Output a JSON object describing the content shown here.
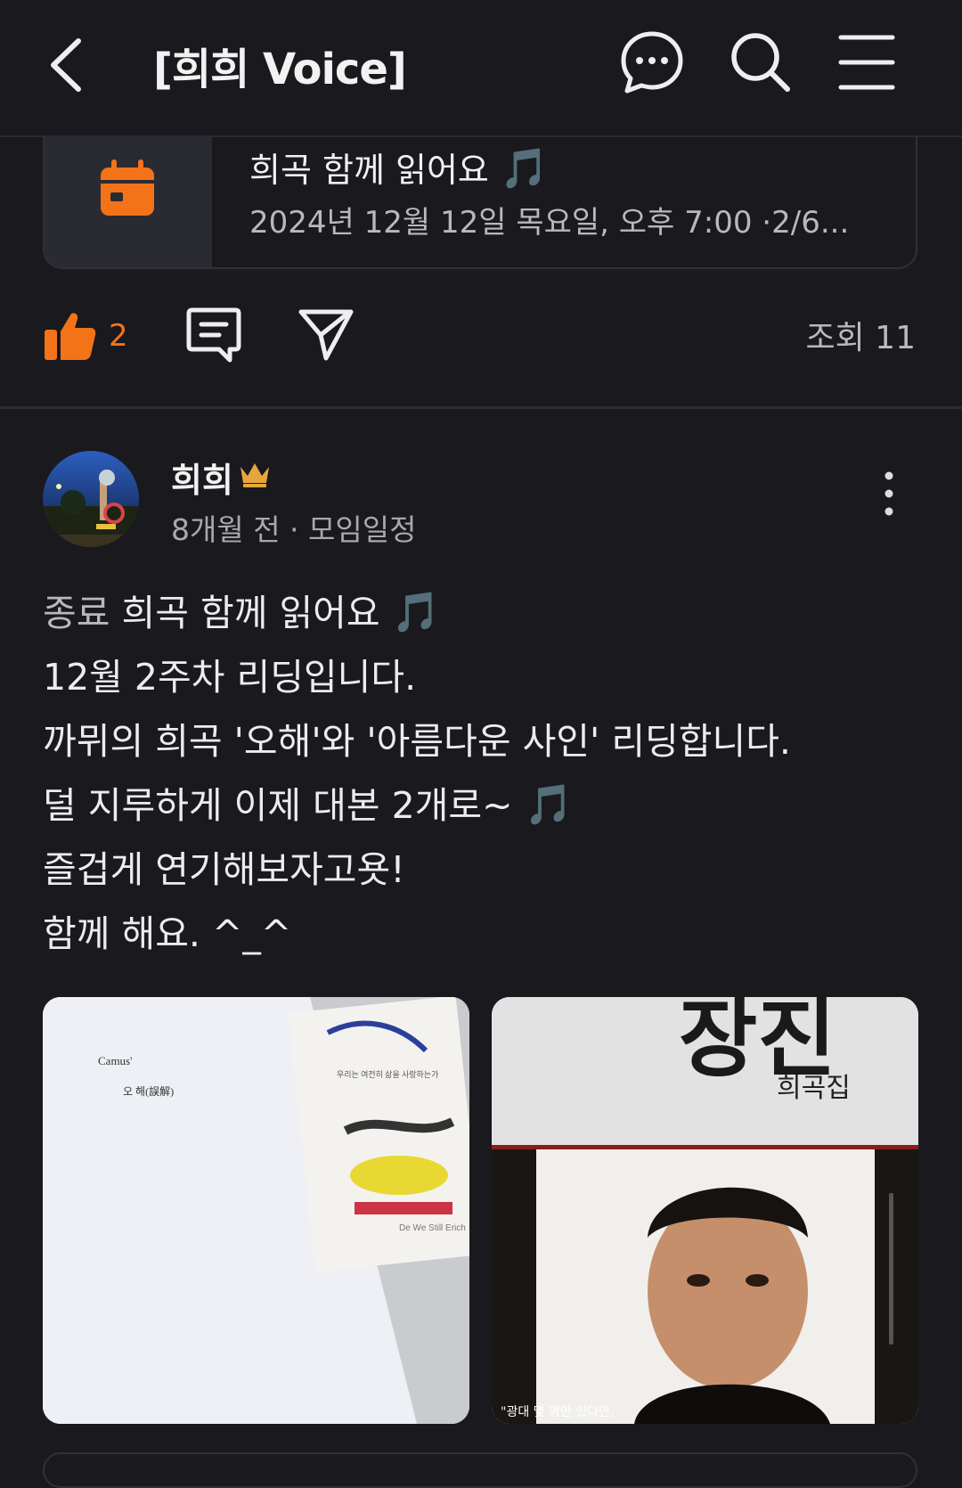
{
  "header": {
    "title": "[희희 Voice]",
    "back_icon": "chevron-left-icon",
    "chat_icon": "chat-bubble-icon",
    "search_icon": "search-icon",
    "menu_icon": "hamburger-menu-icon"
  },
  "event": {
    "title": "희곡 함께 읽어요",
    "subtitle": "2024년 12월 12일 목요일, 오후 7:00 ·2/6...",
    "icon": "calendar-icon",
    "icon_color": "#f47318"
  },
  "actions": {
    "like_count": "2",
    "views": "조회 11",
    "accent_color": "#f47318"
  },
  "post": {
    "author": "희희",
    "meta": "8개월 전 · 모임일정",
    "status_label": "종료",
    "title_text": "희곡 함께 읽어요",
    "music_glyph": "🎵",
    "lines": [
      "12월 2주차 리딩입니다.",
      "까뮈의 희곡 '오해'와 '아름다운 사인' 리딩합니다.",
      "덜 지루하게 이제 대본 2개로~",
      "즐겁게 연기해보자고욧!",
      "함께 해요. ^_^"
    ]
  },
  "photos": {
    "photo1": {
      "header": "Camus'",
      "title": "오        해(誤解)",
      "book_text": "우리는 여전히 삶을 사랑하는가",
      "book_foot": "De We Still Erich"
    },
    "photo2": {
      "big_title": "장진",
      "subtitle": "희곡집",
      "caption": "\"광대 몇 명만 있다면,"
    }
  }
}
